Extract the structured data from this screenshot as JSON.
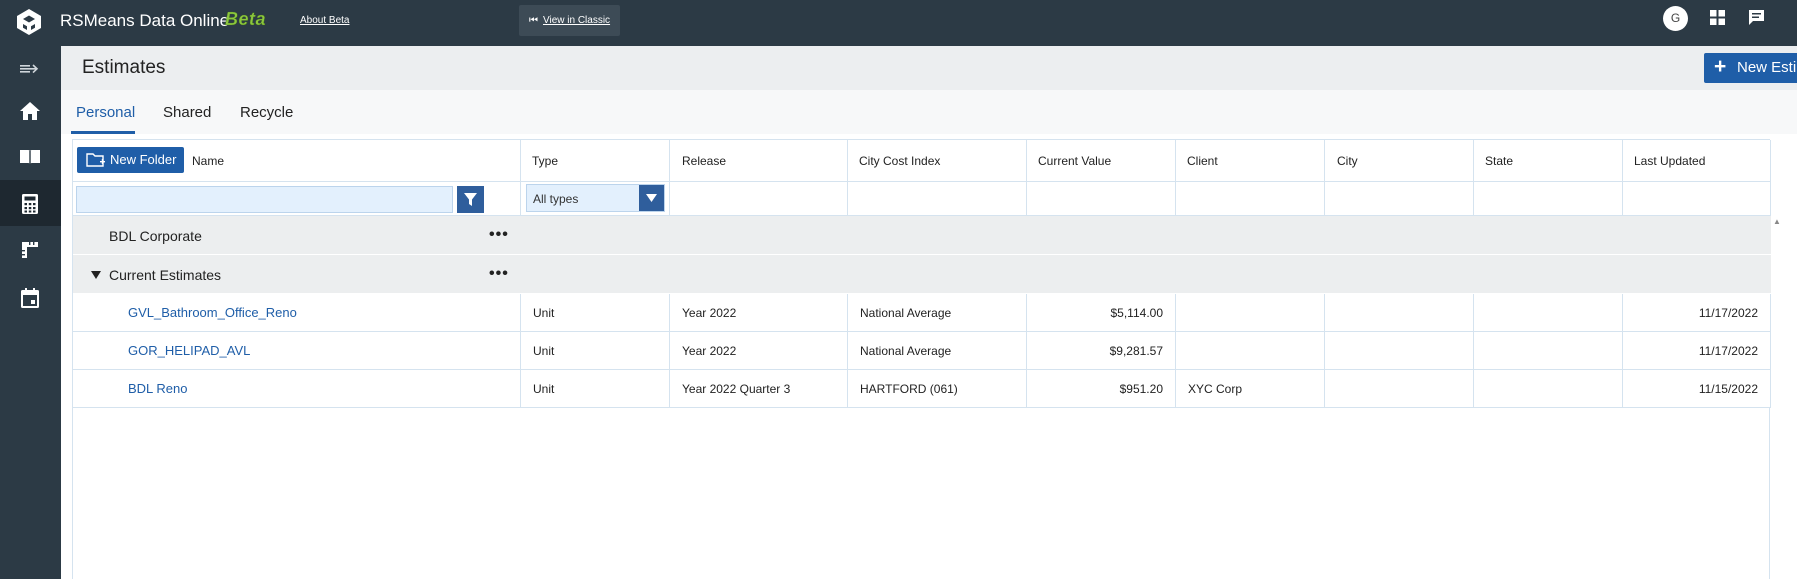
{
  "topbar": {
    "app_title": "RSMeans Data Online",
    "beta_label": "Beta",
    "about_beta": "About Beta",
    "view_classic": "View in Classic",
    "avatar_initial": "G"
  },
  "sidebar": {
    "items": [
      {
        "icon": "expand-menu-icon"
      },
      {
        "icon": "home-icon"
      },
      {
        "icon": "book-icon"
      },
      {
        "icon": "calculator-icon",
        "active": true
      },
      {
        "icon": "ruler-icon"
      },
      {
        "icon": "calendar-icon"
      }
    ]
  },
  "header": {
    "title": "Estimates",
    "new_estimate": "New Estimate"
  },
  "tabs": [
    {
      "label": "Personal",
      "active": true
    },
    {
      "label": "Shared"
    },
    {
      "label": "Recycle"
    }
  ],
  "grid": {
    "new_folder": "New Folder",
    "columns": [
      "Name",
      "Type",
      "Release",
      "City Cost Index",
      "Current Value",
      "Client",
      "City",
      "State",
      "Last Updated"
    ],
    "name_filter_value": "",
    "type_filter": "All types",
    "groups": [
      {
        "name": "BDL Corporate"
      },
      {
        "name": "Current Estimates"
      }
    ],
    "rows": [
      {
        "name": "GVL_Bathroom_Office_Reno",
        "type": "Unit",
        "release": "Year 2022",
        "cci": "National Average",
        "value": "$5,114.00",
        "client": "",
        "city": "",
        "state": "",
        "updated": "11/17/2022"
      },
      {
        "name": "GOR_HELIPAD_AVL",
        "type": "Unit",
        "release": "Year 2022",
        "cci": "National Average",
        "value": "$9,281.57",
        "client": "",
        "city": "",
        "state": "",
        "updated": "11/17/2022"
      },
      {
        "name": "BDL Reno",
        "type": "Unit",
        "release": "Year 2022 Quarter 3",
        "cci": "HARTFORD (061)",
        "value": "$951.20",
        "client": "XYC Corp",
        "city": "",
        "state": "",
        "updated": "11/15/2022"
      }
    ]
  },
  "colors": {
    "topbar": "#2c3a45",
    "accent": "#1f5ea8",
    "beta": "#8cc63f"
  }
}
